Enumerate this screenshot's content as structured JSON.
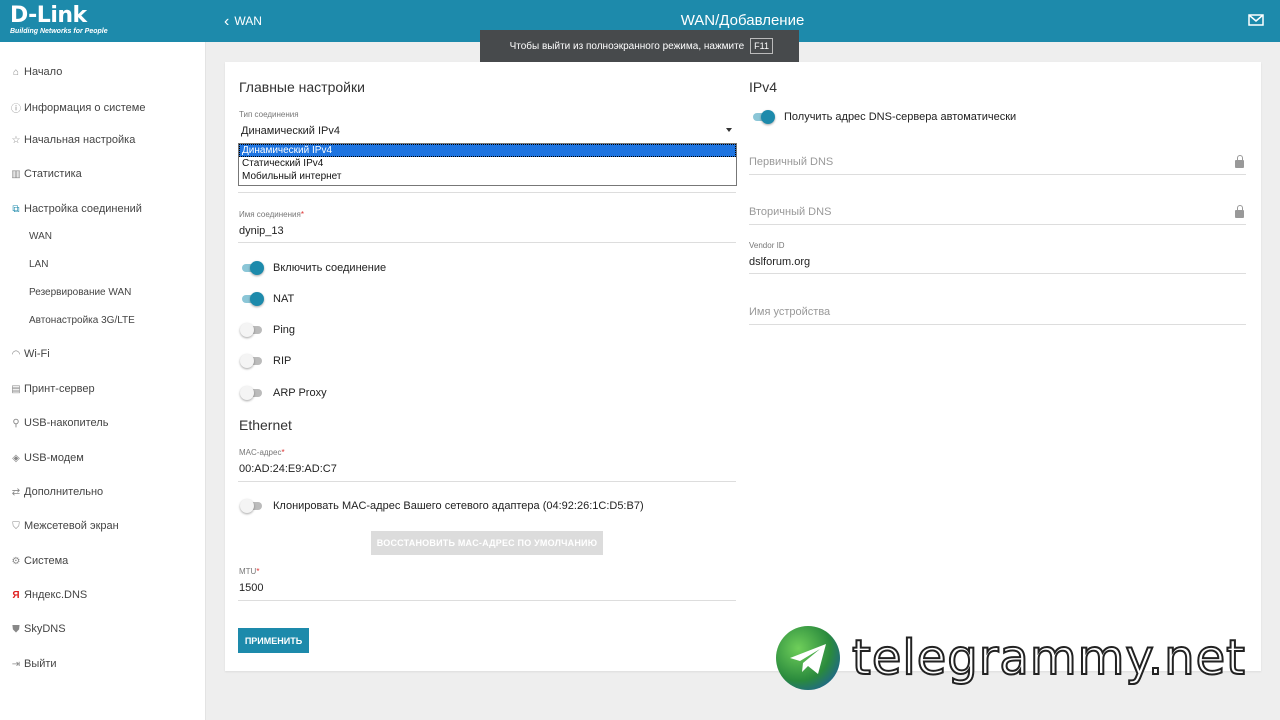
{
  "brand": {
    "name": "D-Link",
    "tagline": "Building Networks for People"
  },
  "header": {
    "back_label": "WAN",
    "title": "WAN/Добавление"
  },
  "toast": {
    "text": "Чтобы выйти из полноэкранного режима, нажмите",
    "key": "F11"
  },
  "sidebar": {
    "items": [
      {
        "label": "Начало",
        "icon": "home-icon"
      },
      {
        "label": "Информация о системе",
        "icon": "info-icon"
      },
      {
        "label": "Начальная настройка",
        "icon": "wizard-icon"
      },
      {
        "label": "Статистика",
        "icon": "stats-icon"
      },
      {
        "label": "Настройка соединений",
        "icon": "connections-icon"
      },
      {
        "label": "Wi-Fi",
        "icon": "wifi-icon"
      },
      {
        "label": "Принт-сервер",
        "icon": "printer-icon"
      },
      {
        "label": "USB-накопитель",
        "icon": "usb-icon"
      },
      {
        "label": "USB-модем",
        "icon": "modem-icon"
      },
      {
        "label": "Дополнительно",
        "icon": "advanced-icon"
      },
      {
        "label": "Межсетевой экран",
        "icon": "firewall-icon"
      },
      {
        "label": "Система",
        "icon": "system-icon"
      },
      {
        "label": "Яндекс.DNS",
        "icon": "yandex-icon"
      },
      {
        "label": "SkyDNS",
        "icon": "skydns-icon"
      },
      {
        "label": "Выйти",
        "icon": "logout-icon"
      }
    ],
    "subitems": [
      "WAN",
      "LAN",
      "Резервирование WAN",
      "Автонастройка 3G/LTE"
    ]
  },
  "main": {
    "section_title": "Главные настройки",
    "conn_type": {
      "label": "Тип соединения",
      "value": "Динамический IPv4",
      "options": [
        "Динамический IPv4",
        "Статический IPv4",
        "Мобильный интернет"
      ]
    },
    "conn_name": {
      "label": "Имя соединения",
      "value": "dynip_13"
    },
    "toggles": [
      {
        "label": "Включить соединение",
        "on": true
      },
      {
        "label": "NAT",
        "on": true
      },
      {
        "label": "Ping",
        "on": false
      },
      {
        "label": "RIP",
        "on": false
      },
      {
        "label": "ARP Proxy",
        "on": false
      }
    ],
    "ethernet": {
      "title": "Ethernet",
      "mac_label": "MAC-адрес",
      "mac_value": "00:AD:24:E9:AD:C7",
      "clone_label": "Клонировать MAC-адрес Вашего сетевого адаптера (04:92:26:1C:D5:B7)",
      "restore_button": "ВОССТАНОВИТЬ MAC-АДРЕС ПО УМОЛЧАНИЮ"
    },
    "mtu": {
      "label": "MTU",
      "value": "1500"
    },
    "apply_button": "ПРИМЕНИТЬ"
  },
  "ipv4": {
    "title": "IPv4",
    "dns_auto_label": "Получить адрес DNS-сервера автоматически",
    "dns_auto_on": true,
    "primary_dns_placeholder": "Первичный DNS",
    "secondary_dns_placeholder": "Вторичный DNS",
    "vendor_label": "Vendor ID",
    "vendor_value": "dslforum.org",
    "device_name_placeholder": "Имя устройства"
  },
  "watermark": "telegrammy.net",
  "colors": {
    "accent": "#1d8aab",
    "background": "#eeeeee"
  }
}
